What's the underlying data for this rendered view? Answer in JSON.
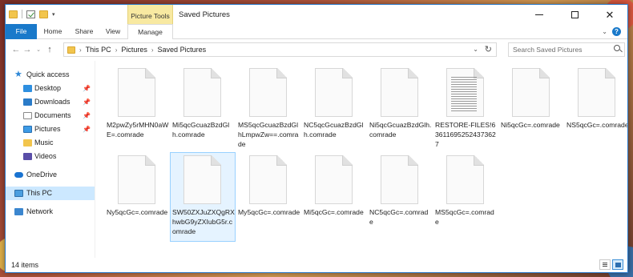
{
  "window": {
    "title": "Saved Pictures",
    "picture_tools": "Picture Tools"
  },
  "ribbon": {
    "file": "File",
    "home": "Home",
    "share": "Share",
    "view": "View",
    "manage": "Manage"
  },
  "address": {
    "crumbs": [
      "This PC",
      "Pictures",
      "Saved Pictures"
    ]
  },
  "search": {
    "placeholder": "Search Saved Pictures"
  },
  "nav": {
    "quick_access": "Quick access",
    "desktop": "Desktop",
    "downloads": "Downloads",
    "documents": "Documents",
    "pictures": "Pictures",
    "music": "Music",
    "videos": "Videos",
    "onedrive": "OneDrive",
    "this_pc": "This PC",
    "network": "Network"
  },
  "files": [
    {
      "name": "M2pwZy5rMHN0aWE=.comrade",
      "type": "blank"
    },
    {
      "name": "Mi5qcGcuazBzdGlh.comrade",
      "type": "blank"
    },
    {
      "name": "MS5qcGcuazBzdGlhLmpwZw==.comrade",
      "type": "blank"
    },
    {
      "name": "NC5qcGcuazBzdGlh.comrade",
      "type": "blank"
    },
    {
      "name": "Ni5qcGcuazBzdGlh.comrade",
      "type": "blank"
    },
    {
      "name": "RESTORE-FILES!636116952524373627",
      "type": "text"
    },
    {
      "name": "Ni5qcGc=.comrade",
      "type": "blank"
    },
    {
      "name": "NS5qcGc=.comrade",
      "type": "blank"
    },
    {
      "name": "Ny5qcGc=.comrade",
      "type": "blank"
    },
    {
      "name": "SW50ZXJuZXQgRXhwbG9yZXIubG5r.comrade",
      "type": "blank",
      "selected": true
    },
    {
      "name": "My5qcGc=.comrade",
      "type": "blank"
    },
    {
      "name": "Mi5qcGc=.comrade",
      "type": "blank"
    },
    {
      "name": "NC5qcGc=.comrade",
      "type": "blank"
    },
    {
      "name": "MS5qcGc=.comrade",
      "type": "blank"
    }
  ],
  "status": {
    "item_count": "14 items"
  }
}
